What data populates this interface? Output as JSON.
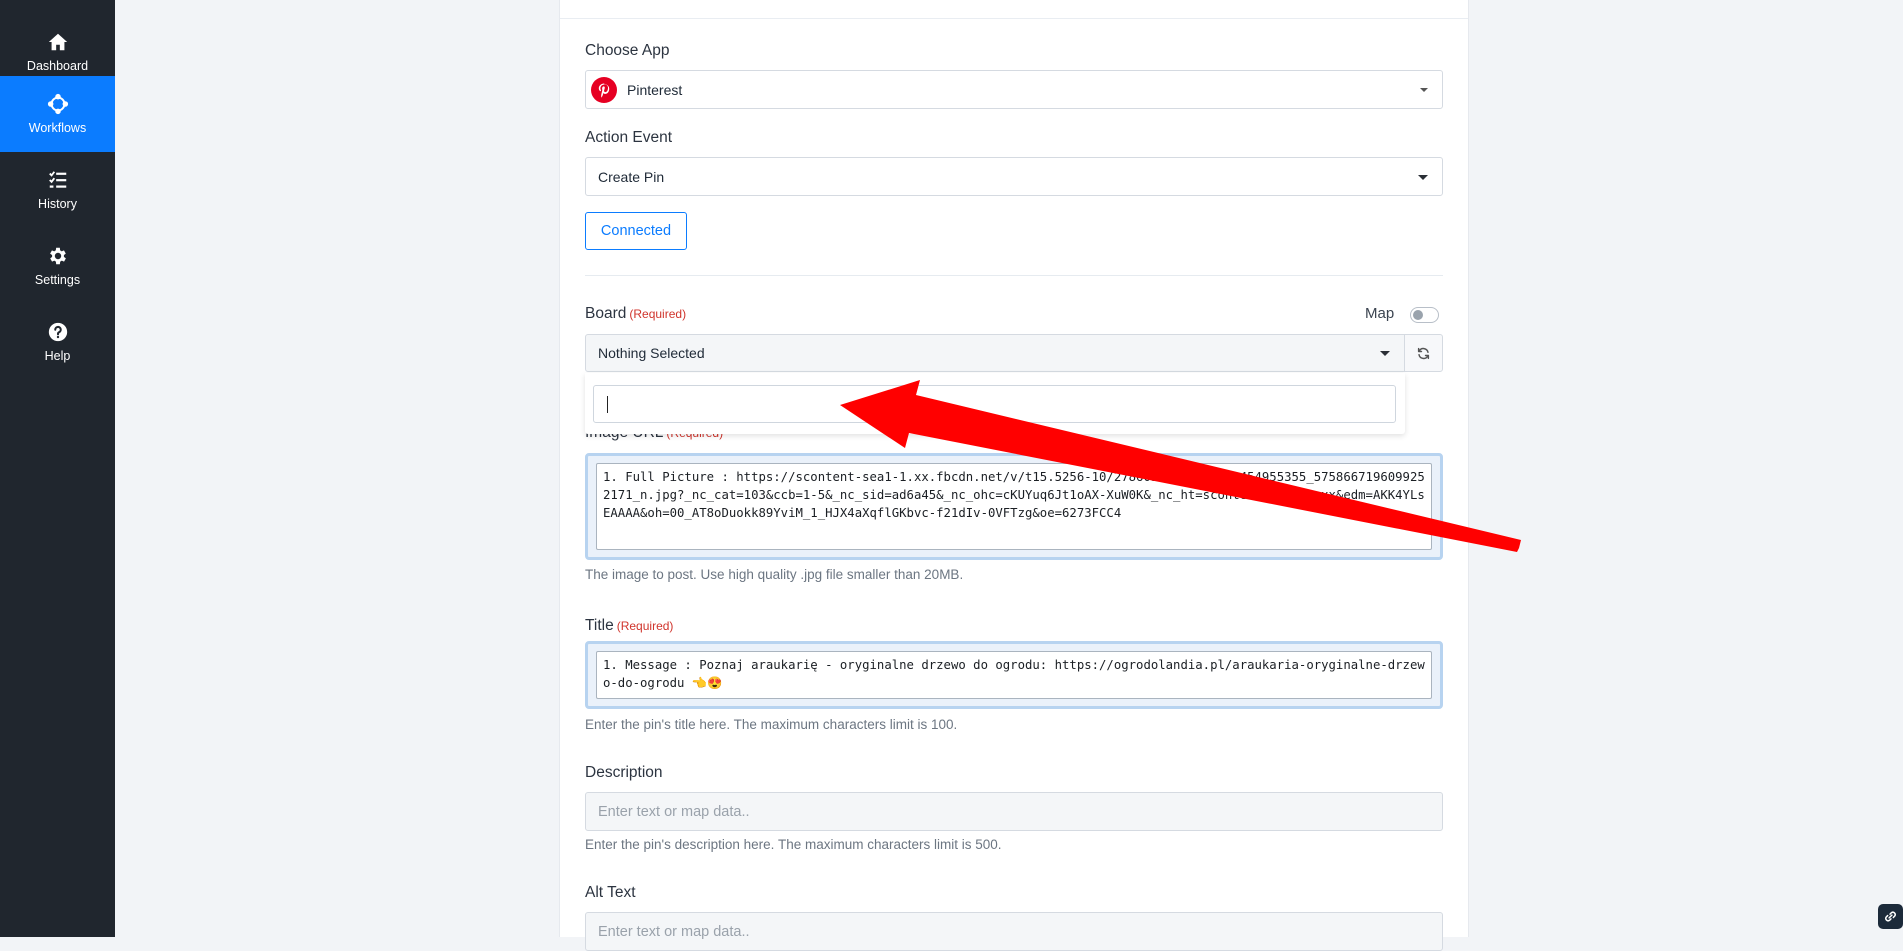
{
  "sidebar": {
    "items": [
      {
        "label": "Dashboard",
        "icon": "home-icon",
        "active": false
      },
      {
        "label": "Workflows",
        "icon": "workflow-icon",
        "active": true
      },
      {
        "label": "History",
        "icon": "history-list-icon",
        "active": false
      },
      {
        "label": "Settings",
        "icon": "gear-icon",
        "active": false
      },
      {
        "label": "Help",
        "icon": "help-circle-icon",
        "active": false
      }
    ]
  },
  "form": {
    "choose_app": {
      "label": "Choose App",
      "value": "Pinterest"
    },
    "action_event": {
      "label": "Action Event",
      "value": "Create Pin"
    },
    "connected_label": "Connected",
    "board": {
      "label": "Board",
      "required": "(Required)",
      "map_label": "Map",
      "value": "Nothing Selected",
      "search_value": ""
    },
    "image_url": {
      "label": "Image URL",
      "required": "(Required)",
      "value": "1. Full Picture : https://scontent-sea1-1.xx.fbcdn.net/v/t15.5256-10/278605578_1191959454955355_5758667196099252171_n.jpg?_nc_cat=103&ccb=1-5&_nc_sid=ad6a45&_nc_ohc=cKUYuq6Jt1oAX-XuW0K&_nc_ht=scontent-sea1-1.xx&edm=AKK4YLsEAAAA&oh=00_AT8oDuokk89YviM_1_HJX4aXqflGKbvc-f21dIv-0VFTzg&oe=6273FCC4",
      "hint": "The image to post. Use high quality .jpg file smaller than 20MB."
    },
    "title": {
      "label": "Title",
      "required": "(Required)",
      "value": "1. Message : Poznaj araukarię - oryginalne drzewo do ogrodu: https://ogrodolandia.pl/araukaria-oryginalne-drzewo-do-ogrodu 👈😍",
      "hint": "Enter the pin's title here. The maximum characters limit is 100."
    },
    "description": {
      "label": "Description",
      "placeholder": "Enter text or map data..",
      "hint": "Enter the pin's description here. The maximum characters limit is 500."
    },
    "alt_text": {
      "label": "Alt Text",
      "placeholder": "Enter text or map data.."
    }
  },
  "colors": {
    "sidebar_bg": "#20262e",
    "accent": "#0b7cff",
    "required": "#d0342c",
    "pinterest": "#e60023",
    "arrow": "#ff0000"
  }
}
